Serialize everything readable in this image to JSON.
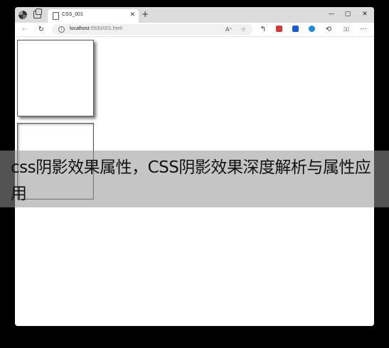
{
  "browser": {
    "tab": {
      "title": "CSS_001",
      "close": "✕"
    },
    "new_tab": "+",
    "window_controls": {
      "minimize": "—",
      "maximize": "▢",
      "close": "✕"
    },
    "nav": {
      "back": "←",
      "refresh": "↻"
    },
    "address": {
      "host": "localhost",
      "path": ":5500/001.html",
      "info": "i"
    },
    "address_icons": {
      "read_aloud": "Aᴬ",
      "favorite": "☆"
    },
    "toolbar_icons": {
      "share": "↰",
      "split_screen": "▯▯",
      "menu": "···",
      "extensions": "⟲"
    }
  },
  "overlay": {
    "caption": "css阴影效果属性，CSS阴影效果深度解析与属性应用"
  },
  "colors": {
    "overlay_band": "#969696",
    "window_background": "#ffffff",
    "tabstrip_background": "#dcdcdc"
  }
}
